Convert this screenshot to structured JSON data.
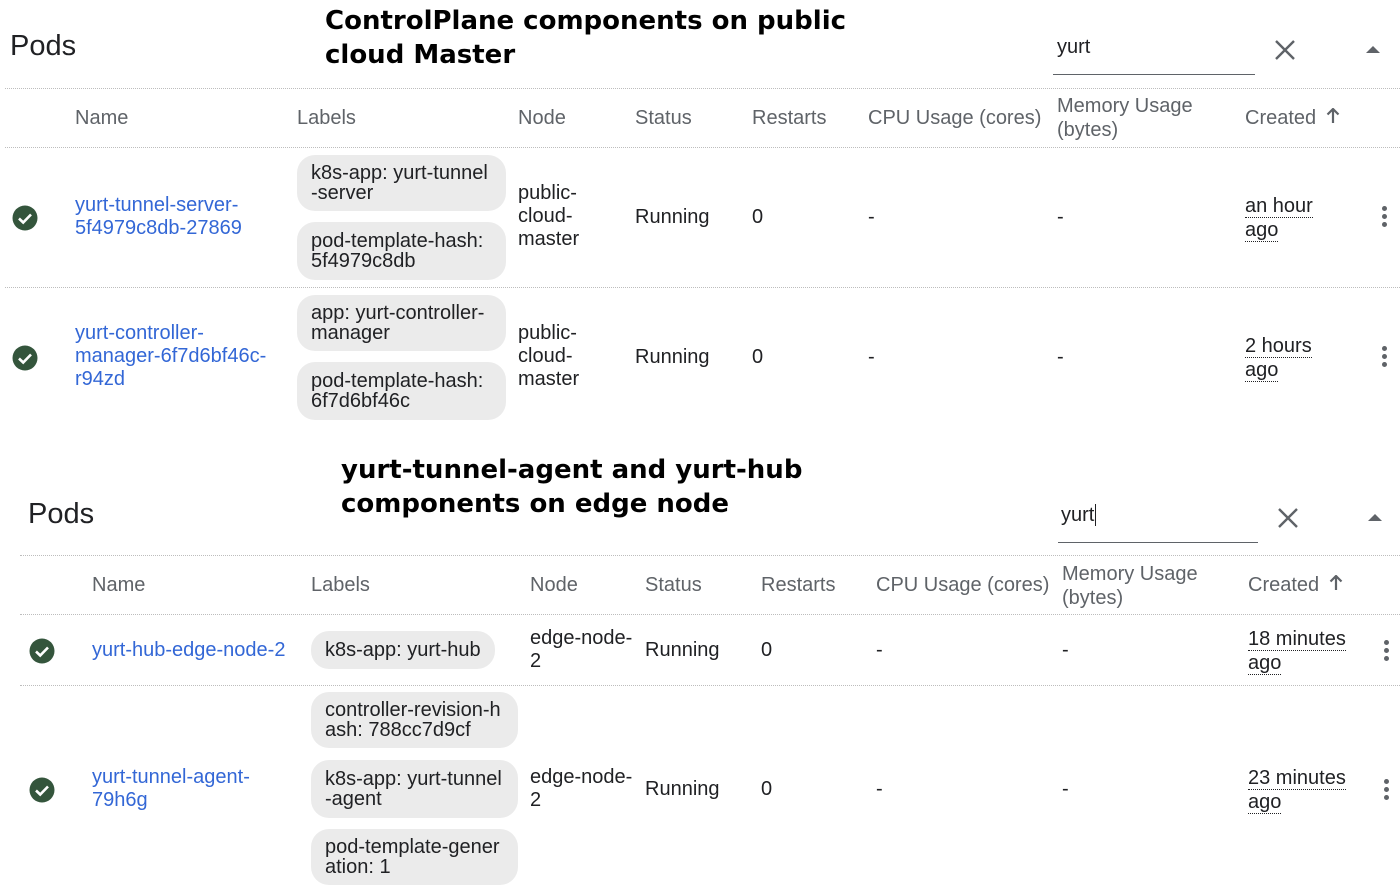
{
  "panels": [
    {
      "title": "Pods",
      "annotation": [
        "ControlPlane components on public",
        "cloud Master"
      ],
      "search_value": "yurt",
      "headers": {
        "name": "Name",
        "labels": "Labels",
        "node": "Node",
        "status": "Status",
        "restarts": "Restarts",
        "cpu": "CPU Usage (cores)",
        "memory_1": "Memory Usage",
        "memory_2": "(bytes)",
        "created": "Created"
      },
      "rows": [
        {
          "name": [
            "yurt-tunnel-server-",
            "5f4979c8db-27869"
          ],
          "labels": [
            "k8s-app: yurt-tunnel-server",
            "pod-template-hash: 5f4979c8db"
          ],
          "node": [
            "public-",
            "cloud-",
            "master"
          ],
          "status": "Running",
          "restarts": "0",
          "cpu": "-",
          "memory": "-",
          "created": [
            "an hour",
            "ago"
          ]
        },
        {
          "name": [
            "yurt-controller-",
            "manager-6f7d6bf46c-",
            "r94zd"
          ],
          "labels": [
            "app: yurt-controller-manager",
            "pod-template-hash: 6f7d6bf46c"
          ],
          "node": [
            "public-",
            "cloud-",
            "master"
          ],
          "status": "Running",
          "restarts": "0",
          "cpu": "-",
          "memory": "-",
          "created": [
            "2 hours",
            "ago"
          ]
        }
      ]
    },
    {
      "title": "Pods",
      "annotation": [
        "yurt-tunnel-agent and yurt-hub",
        "components on edge node"
      ],
      "search_value": "yurt",
      "headers": {
        "name": "Name",
        "labels": "Labels",
        "node": "Node",
        "status": "Status",
        "restarts": "Restarts",
        "cpu": "CPU Usage (cores)",
        "memory_1": "Memory Usage",
        "memory_2": "(bytes)",
        "created": "Created"
      },
      "rows": [
        {
          "name": [
            "yurt-hub-edge-node-2"
          ],
          "labels": [
            "k8s-app: yurt-hub"
          ],
          "node": [
            "edge-node-",
            "2"
          ],
          "status": "Running",
          "restarts": "0",
          "cpu": "-",
          "memory": "-",
          "created": [
            "18 minutes",
            "ago"
          ]
        },
        {
          "name": [
            "yurt-tunnel-agent-",
            "79h6g"
          ],
          "labels": [
            "controller-revision-hash: 788cc7d9cf",
            "k8s-app: yurt-tunnel-agent",
            "pod-template-generation: 1"
          ],
          "node": [
            "edge-node-",
            "2"
          ],
          "status": "Running",
          "restarts": "0",
          "cpu": "-",
          "memory": "-",
          "created": [
            "23 minutes",
            "ago"
          ]
        }
      ]
    }
  ],
  "colors": {
    "link": "#3367d6",
    "status_ok": "#34553c",
    "chip_bg": "#ebebeb"
  },
  "icons": {
    "status": "check-circle-icon",
    "clear": "close-icon",
    "collapse": "arrow-drop-up-icon",
    "sort": "arrow-up-icon",
    "menu": "more-vert-icon"
  }
}
